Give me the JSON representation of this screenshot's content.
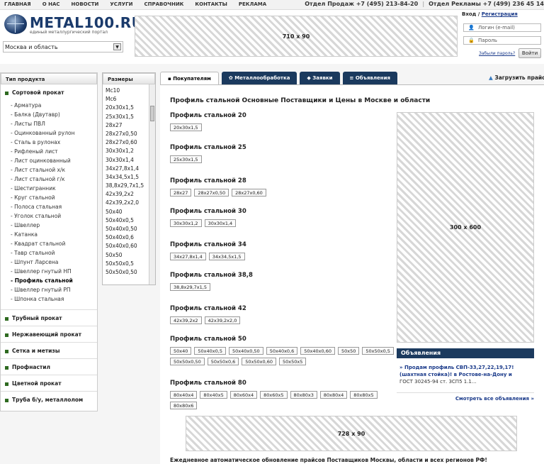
{
  "topbar": {
    "nav": [
      "ГЛАВНАЯ",
      "О НАС",
      "НОВОСТИ",
      "УСЛУГИ",
      "СПРАВОЧНИК",
      "КОНТАКТЫ",
      "РЕКЛАМА"
    ],
    "sales": "Отдел Продаж +7 (495) 213-84-20",
    "ads": "Отдел Рекламы +7 (499) 236 45 14"
  },
  "logo": {
    "name": "METAL100.RU",
    "tagline": "единый металлургический портал"
  },
  "region": {
    "value": "Москва и область"
  },
  "banners": {
    "top": "710 x 90",
    "side": "300 x 600",
    "bottom": "728 x 90"
  },
  "login": {
    "title_prefix": "Вход / ",
    "register": "Регистрация",
    "login_placeholder": "Логин (e-mail)",
    "password_placeholder": "Пароль",
    "forgot": "Забыли пароль?",
    "button": "Войти"
  },
  "sidebar": {
    "header": "Тип продукта",
    "active_category": "Сортовой прокат",
    "subitems": [
      "Арматура",
      "Балка (Двутавр)",
      "Листы ПВЛ",
      "Оцинкованный рулон",
      "Сталь в рулонах",
      "Рифленый лист",
      "Лист оцинкованный",
      "Лист стальной х/к",
      "Лист стальной г/к",
      "Шестигранник",
      "Круг стальной",
      "Полоса стальная",
      "Уголок стальной",
      "Швеллер",
      "Катанка",
      "Квадрат стальной",
      "Тавр стальной",
      "Шпунт Ларсена",
      "Швеллер гнутый НП",
      "Профиль стальной",
      "Швеллер гнутый РП",
      "Шпонка стальная"
    ],
    "active_subitem": "Профиль стальной",
    "categories": [
      "Трубный прокат",
      "Нержавеющий прокат",
      "Сетка и метизы",
      "Профнастил",
      "Цветной прокат",
      "Труба б/у, металлолом"
    ]
  },
  "sizes": {
    "header": "Размеры",
    "items": [
      "Мс10",
      "Мс6",
      "20x30x1,5",
      "25x30x1,5",
      "28x27",
      "28x27x0,50",
      "28x27x0,60",
      "30x30x1,2",
      "30x30x1,4",
      "34x27,8x1,4",
      "34x34,5x1,5",
      "38,8x29,7x1,5",
      "42x39,2x2",
      "42x39,2x2,0",
      "50x40",
      "50x40x0,5",
      "50x40x0,50",
      "50x40x0,6",
      "50x40x0,60",
      "50x50",
      "50x50x0,5",
      "50x50x0,50"
    ]
  },
  "tabs": [
    "Покупателям",
    "Металлообработка",
    "Заявки",
    "Объявления"
  ],
  "upload": "Загрузить прайс",
  "page_title": "Профиль стальной Основные Поставщики и Цены в Москве и области",
  "groups": [
    {
      "title": "Профиль стальной 20",
      "chips": [
        "20x30x1,5"
      ]
    },
    {
      "title": "Профиль стальной 25",
      "chips": [
        "25x30x1,5"
      ]
    },
    {
      "title": "Профиль стальной 28",
      "chips": [
        "28x27",
        "28x27x0,50",
        "28x27x0,60"
      ]
    },
    {
      "title": "Профиль стальной 30",
      "chips": [
        "30x30x1,2",
        "30x30x1,4"
      ]
    },
    {
      "title": "Профиль стальной 34",
      "chips": [
        "34x27,8x1,4",
        "34x34,5x1,5"
      ]
    },
    {
      "title": "Профиль стальной 38,8",
      "chips": [
        "38,8x29,7x1,5"
      ]
    },
    {
      "title": "Профиль стальной 42",
      "chips": [
        "42x39,2x2",
        "42x39,2x2,0"
      ]
    },
    {
      "title": "Профиль стальной 50",
      "chips": [
        "50x40",
        "50x40x0,5",
        "50x40x0,50",
        "50x40x0,6",
        "50x40x0,60",
        "50x50",
        "50x50x0,5",
        "50x50x0,50",
        "50x50x0,6",
        "50x50x0,60",
        "50x50x5"
      ]
    },
    {
      "title": "Профиль стальной 80",
      "chips": [
        "80x40x4",
        "80x40x5",
        "80x60x4",
        "80x60x5",
        "80x80x3",
        "80x80x4",
        "80x80x5",
        "80x80x6"
      ]
    }
  ],
  "ads": {
    "header": "Объявления",
    "item_title": "» Продам профиль СВП-33,27,22,19,17! (шахтная стойка)! в Ростове-на-Дону и",
    "item_gost": "ГОСТ 30245-94 ст. 3СП5 1.1...",
    "more": "Смотреть все объявления »"
  },
  "footer": "Ежедневное автоматическое обновление прайсов Поставщиков Москвы, области и всех регионов РФ!"
}
